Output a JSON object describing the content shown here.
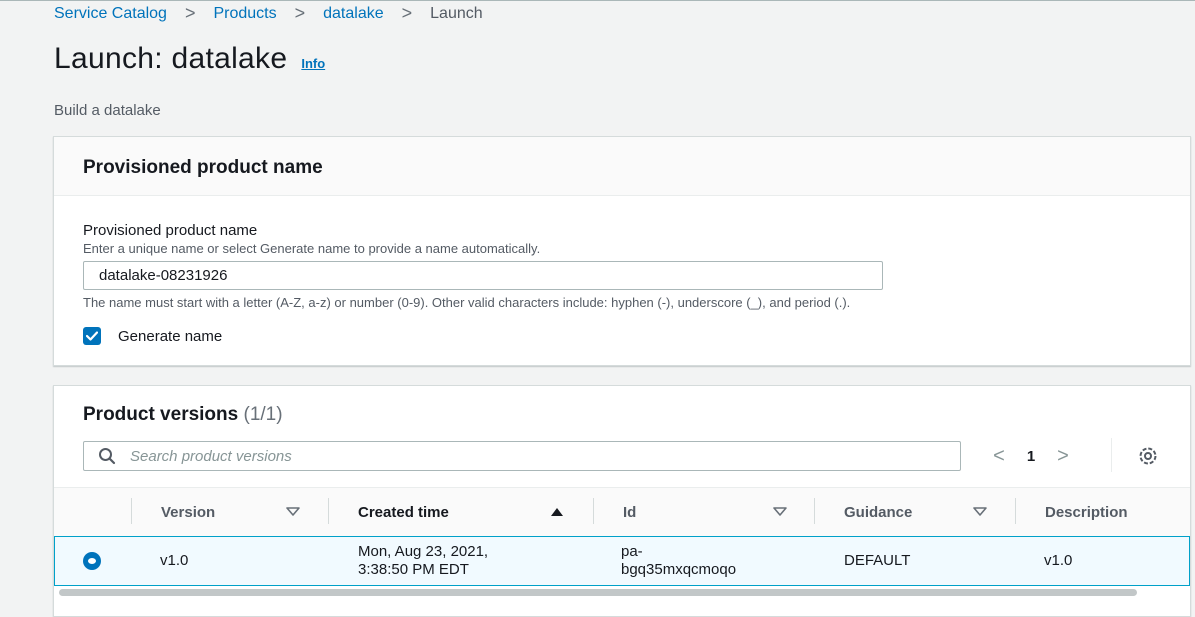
{
  "breadcrumb": [
    {
      "label": "Service Catalog"
    },
    {
      "label": "Products"
    },
    {
      "label": "datalake"
    },
    {
      "label": "Launch"
    }
  ],
  "page": {
    "title": "Launch: datalake",
    "info_label": "Info",
    "subtitle": "Build a datalake"
  },
  "name_panel": {
    "header": "Provisioned product name",
    "field_label": "Provisioned product name",
    "field_description": "Enter a unique name or select Generate name to provide a name automatically.",
    "field_value": "datalake-08231926",
    "constraint_text": "The name must start with a letter (A-Z, a-z) or number (0-9). Other valid characters include: hyphen (-), underscore (_), and period (.).",
    "generate_name_label": "Generate name",
    "generate_name_checked": true
  },
  "versions_panel": {
    "header": "Product versions",
    "count": "(1/1)",
    "search_placeholder": "Search product versions",
    "current_page": "1",
    "columns": [
      {
        "label": "Version",
        "sort": "none"
      },
      {
        "label": "Created time",
        "sort": "ascending"
      },
      {
        "label": "Id",
        "sort": "none"
      },
      {
        "label": "Guidance",
        "sort": "none"
      },
      {
        "label": "Description",
        "sort": "none"
      }
    ],
    "rows": [
      {
        "selected": true,
        "version": "v1.0",
        "created_line1": "Mon, Aug 23, 2021,",
        "created_line2": "3:38:50 PM EDT",
        "id_line1": "pa-",
        "id_line2": "bgq35mxqcmoqo",
        "guidance": "DEFAULT",
        "description": "v1.0"
      }
    ]
  },
  "colors": {
    "link": "#0073bb",
    "accent": "#0073bb",
    "selected_row_bg": "#f1faff",
    "selected_row_border": "#00a1c9",
    "page_bg": "#f2f3f3"
  }
}
